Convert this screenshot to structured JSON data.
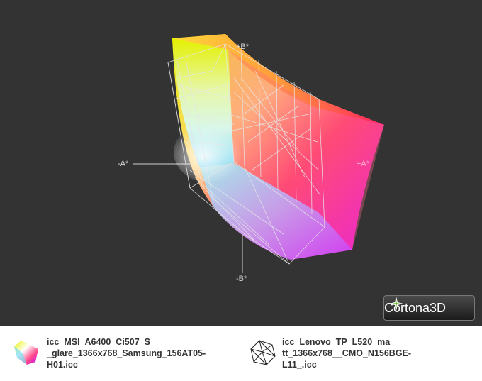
{
  "viewer": {
    "axes": {
      "b_plus": "+B*",
      "b_minus": "-B*",
      "a_minus": "-A*",
      "a_plus": "+A*"
    },
    "logo_text": "Cortona3D",
    "background_color": "#333333"
  },
  "legend": {
    "items": [
      {
        "lines": [
          "icc_MSI_A6400_Ci507_S",
          "_glare_1366x768_Samsung_156AT05-",
          "H01.icc"
        ],
        "icon": "color-gamut-solid-icon"
      },
      {
        "lines": [
          "icc_Lenovo_TP_L520_ma",
          "tt_1366x768__CMO_N156BGE-",
          "L11_.icc"
        ],
        "icon": "wireframe-gamut-icon"
      }
    ]
  }
}
